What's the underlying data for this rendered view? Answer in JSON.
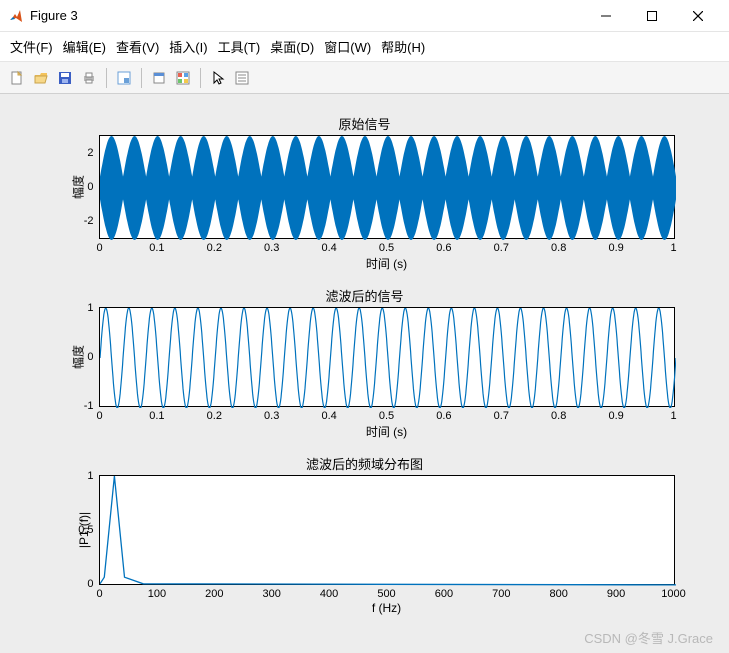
{
  "window": {
    "title": "Figure 3"
  },
  "menu": {
    "items": [
      "文件(F)",
      "编辑(E)",
      "查看(V)",
      "插入(I)",
      "工具(T)",
      "桌面(D)",
      "窗口(W)",
      "帮助(H)"
    ]
  },
  "toolbar_icons": [
    "new-file-icon",
    "open-icon",
    "save-icon",
    "print-icon",
    "data-cursor-icon",
    "link-icon",
    "colorbar-icon",
    "legend-icon",
    "pointer-icon",
    "properties-icon"
  ],
  "colors": {
    "line": "#0072BD",
    "axes_bg": "#ffffff",
    "figure_bg": "#ededed"
  },
  "watermark": "CSDN @冬雪 J.Grace",
  "chart_data": [
    {
      "type": "line",
      "title": "原始信号",
      "xlabel": "时间 (s)",
      "ylabel": "幅度",
      "xlim": [
        0,
        1
      ],
      "ylim": [
        -3,
        3
      ],
      "xticks": [
        0,
        0.1,
        0.2,
        0.3,
        0.4,
        0.5,
        0.6,
        0.7,
        0.8,
        0.9,
        1
      ],
      "yticks": [
        -2,
        0,
        2
      ],
      "description": "Sum of sinusoids producing an AM-like waveform with dense high-frequency carrier and a ~25 Hz envelope spanning roughly ±3 in amplitude.",
      "envelope_peak": 3,
      "envelope_freq_hz": 25
    },
    {
      "type": "line",
      "title": "滤波后的信号",
      "xlabel": "时间 (s)",
      "ylabel": "幅度",
      "xlim": [
        0,
        1
      ],
      "ylim": [
        -1,
        1
      ],
      "xticks": [
        0,
        0.1,
        0.2,
        0.3,
        0.4,
        0.5,
        0.6,
        0.7,
        0.8,
        0.9,
        1
      ],
      "yticks": [
        -1,
        0,
        1
      ],
      "description": "Single sinusoid after filtering, amplitude ≈1, frequency ≈25 Hz.",
      "frequency_hz": 25,
      "amplitude": 1
    },
    {
      "type": "line",
      "title": "滤波后的频域分布图",
      "xlabel": "f (Hz)",
      "ylabel": "|P1₁(f)|",
      "xlim": [
        0,
        1000
      ],
      "ylim": [
        0,
        1
      ],
      "xticks": [
        0,
        100,
        200,
        300,
        400,
        500,
        600,
        700,
        800,
        900,
        1000
      ],
      "yticks": [
        0,
        0.5,
        1
      ],
      "description": "Single-sided amplitude spectrum with a ~1.0 peak near 25 Hz and near-zero elsewhere.",
      "peak_freq_hz": 25,
      "peak_magnitude": 1
    }
  ]
}
